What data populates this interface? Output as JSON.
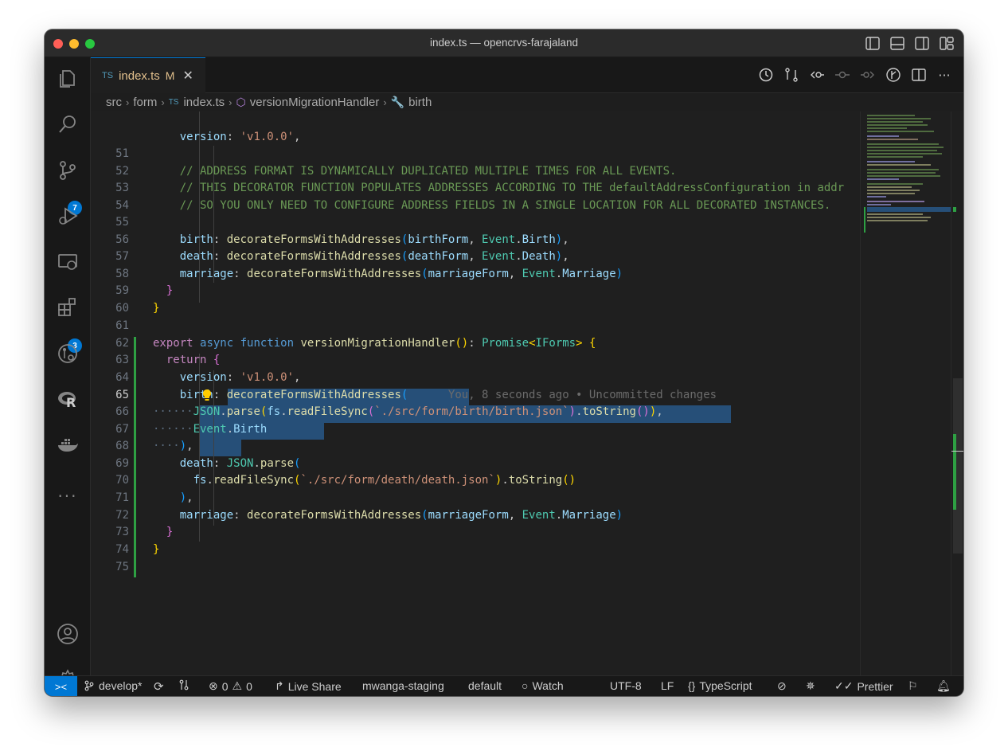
{
  "window": {
    "title": "index.ts — opencrvs-farajaland"
  },
  "activity": {
    "items": [
      {
        "name": "explorer"
      },
      {
        "name": "search"
      },
      {
        "name": "source-control",
        "badge": "7"
      },
      {
        "name": "run-debug"
      },
      {
        "name": "remote-explorer"
      },
      {
        "name": "extensions",
        "badge": "3"
      },
      {
        "name": "gitlens"
      },
      {
        "name": "r"
      },
      {
        "name": "docker"
      },
      {
        "name": "more",
        "label": "..."
      }
    ]
  },
  "tab": {
    "lang": "TS",
    "filename": "index.ts",
    "status": "M",
    "close": "✕"
  },
  "breadcrumb": {
    "parts": [
      "src",
      "form",
      "index.ts",
      "versionMigrationHandler",
      "birth"
    ],
    "file_lang": "TS"
  },
  "editor": {
    "line_numbers": [
      "51",
      "52",
      "53",
      "54",
      "55",
      "56",
      "57",
      "58",
      "59",
      "60",
      "61",
      "62",
      "63",
      "64",
      "65",
      "66",
      "67",
      "68",
      "69",
      "70",
      "71",
      "72",
      "73",
      "74",
      "75"
    ],
    "active_line": "65",
    "blame": "You, 8 seconds ago • Uncommitted changes",
    "lines": {
      "l52": "// ADDRESS FORMAT IS DYNAMICALLY DUPLICATED MULTIPLE TIMES FOR ALL EVENTS.",
      "l53": "// THIS DECORATOR FUNCTION POPULATES ADDRESSES ACCORDING TO THE defaultAddressConfiguration in addr",
      "l54": "// SO YOU ONLY NEED TO CONFIGURE ADDRESS FIELDS IN A SINGLE LOCATION FOR ALL DECORATED INSTANCES."
    }
  },
  "statusbar": {
    "remote": "><",
    "branch": "develop*",
    "errors": "0",
    "warnings": "0",
    "live_share": "Live Share",
    "profile": "mwanga-staging",
    "profile2": "default",
    "watch": "Watch",
    "encoding": "UTF-8",
    "eol": "LF",
    "language": "TypeScript",
    "prettier": "Prettier"
  },
  "colors": {
    "accent": "#0078d4",
    "git_added": "#2ea043",
    "selection": "#264f78"
  }
}
